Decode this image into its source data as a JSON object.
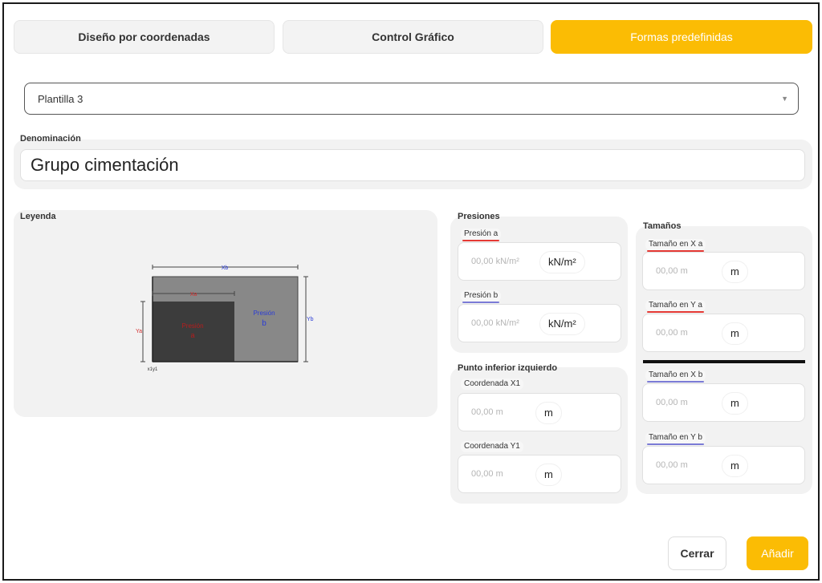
{
  "tabs": [
    {
      "label": "Diseño por coordenadas",
      "active": false
    },
    {
      "label": "Control Gráfico",
      "active": false
    },
    {
      "label": "Formas predefinidas",
      "active": true
    }
  ],
  "template_select": {
    "value": "Plantilla 3"
  },
  "denominacion": {
    "title": "Denominación",
    "value": "Grupo cimentación"
  },
  "leyenda": {
    "title": "Leyenda",
    "diagram": {
      "xb": "Xb",
      "xa": "Xa",
      "ya": "Ya",
      "yb": "Yb",
      "presion_a_line1": "Presión",
      "presion_a_line2": "a",
      "presion_b_line1": "Presión",
      "presion_b_line2": "b",
      "origin": "x1y1"
    }
  },
  "presiones": {
    "title": "Presiones",
    "fields": [
      {
        "label": "Presión a",
        "placeholder": "00,00 kN/m²",
        "unit": "kN/m²"
      },
      {
        "label": "Presión b",
        "placeholder": "00,00 kN/m²",
        "unit": "kN/m²"
      }
    ]
  },
  "punto": {
    "title": "Punto inferior izquierdo",
    "fields": [
      {
        "label": "Coordenada X1",
        "placeholder": "00,00 m",
        "unit": "m"
      },
      {
        "label": "Coordenada Y1",
        "placeholder": "00,00 m",
        "unit": "m"
      }
    ]
  },
  "tamanos": {
    "title": "Tamaños",
    "fields": [
      {
        "label": "Tamaño en X a",
        "placeholder": "00,00 m",
        "unit": "m"
      },
      {
        "label": "Tamaño en Y a",
        "placeholder": "00,00 m",
        "unit": "m"
      },
      {
        "label": "Tamaño en X b",
        "placeholder": "00,00 m",
        "unit": "m"
      },
      {
        "label": "Tamaño en Y b",
        "placeholder": "00,00 m",
        "unit": "m"
      }
    ]
  },
  "actions": {
    "close_label": "Cerrar",
    "add_label": "Añadir"
  },
  "colors": {
    "accent": "#fbbc04",
    "underline_red": "#e53935",
    "underline_blue": "#7b7bd6"
  }
}
